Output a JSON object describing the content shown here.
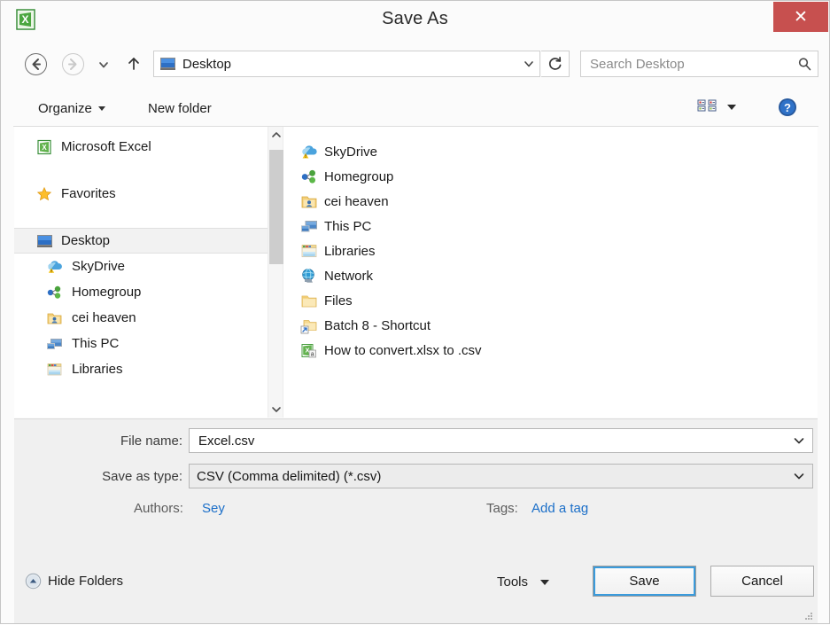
{
  "window": {
    "title": "Save As",
    "app_icon": "excel-icon",
    "close_label": "✕",
    "close_color": "#c7504f"
  },
  "navbar": {
    "back_icon": "back-arrow-icon",
    "forward_icon": "forward-arrow-icon",
    "history_icon": "chevron-down-icon",
    "up_icon": "up-arrow-icon",
    "address_value": "Desktop",
    "address_icon": "desktop-icon",
    "address_chevron": "chevron-down-icon",
    "refresh_icon": "refresh-icon",
    "search_placeholder": "Search Desktop",
    "search_value": "",
    "search_icon": "search-icon"
  },
  "toolbar": {
    "organize_label": "Organize",
    "new_folder_label": "New folder",
    "view_icon": "view-layout-icon",
    "help_icon": "help-icon"
  },
  "nav_pane": {
    "items": [
      {
        "label": "Microsoft Excel",
        "icon": "excel-icon",
        "indent": false,
        "selected": false
      },
      {
        "label": "Favorites",
        "icon": "star-icon",
        "indent": false,
        "selected": false
      },
      {
        "label": "Desktop",
        "icon": "desktop-icon",
        "indent": false,
        "selected": true
      },
      {
        "label": "SkyDrive",
        "icon": "skydrive-icon",
        "indent": true,
        "selected": false
      },
      {
        "label": "Homegroup",
        "icon": "homegroup-icon",
        "indent": true,
        "selected": false
      },
      {
        "label": "cei heaven",
        "icon": "user-folder-icon",
        "indent": true,
        "selected": false
      },
      {
        "label": "This PC",
        "icon": "this-pc-icon",
        "indent": true,
        "selected": false
      },
      {
        "label": "Libraries",
        "icon": "libraries-icon",
        "indent": true,
        "selected": false
      }
    ],
    "scrollbar": {
      "up_icon": "chevron-up-icon",
      "down_icon": "chevron-down-icon"
    }
  },
  "file_pane": {
    "items": [
      {
        "name": "SkyDrive",
        "icon": "skydrive-icon"
      },
      {
        "name": "Homegroup",
        "icon": "homegroup-icon"
      },
      {
        "name": "cei heaven",
        "icon": "user-folder-icon"
      },
      {
        "name": "This PC",
        "icon": "this-pc-icon"
      },
      {
        "name": "Libraries",
        "icon": "libraries-icon"
      },
      {
        "name": "Network",
        "icon": "network-icon"
      },
      {
        "name": "Files",
        "icon": "folder-icon"
      },
      {
        "name": "Batch 8 - Shortcut",
        "icon": "folder-shortcut-icon"
      },
      {
        "name": "How to convert.xlsx to .csv",
        "icon": "excel-file-icon"
      }
    ]
  },
  "form": {
    "file_name_label": "File name:",
    "file_name_value": "Excel.csv",
    "save_as_type_label": "Save as type:",
    "save_as_type_value": "CSV (Comma delimited) (*.csv)",
    "authors_label": "Authors:",
    "authors_value": "Sey",
    "tags_label": "Tags:",
    "tags_value": "Add a tag"
  },
  "footer": {
    "hide_folders_label": "Hide Folders",
    "hide_folders_icon": "collapse-up-icon",
    "tools_label": "Tools",
    "save_label": "Save",
    "cancel_label": "Cancel"
  }
}
